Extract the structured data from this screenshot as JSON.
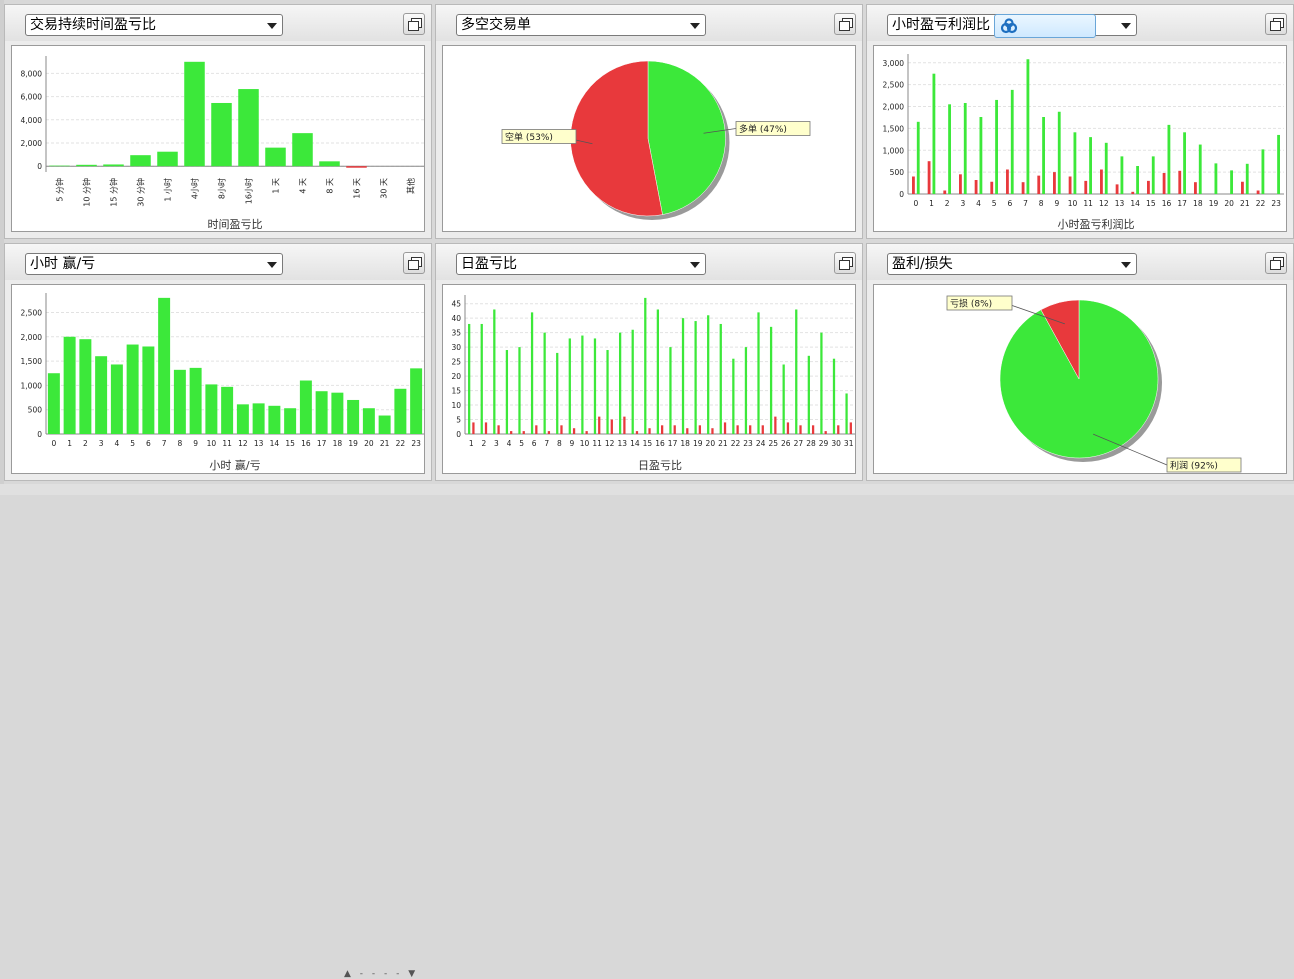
{
  "colors": {
    "green": "#3ce83a",
    "red": "#e8393c",
    "grid": "#e0e0e0"
  },
  "panels": {
    "duration": {
      "select": "交易持续时间盈亏比"
    },
    "longshort": {
      "select": "多空交易单"
    },
    "hourly_pl": {
      "select": "小时盈亏利润比"
    },
    "hour_winloss": {
      "select": "小时 赢/亏"
    },
    "daily_pl": {
      "select": "日盈亏比"
    },
    "profit_loss": {
      "select": "盈利/损失"
    }
  },
  "chart_data": [
    {
      "id": "duration",
      "type": "bar",
      "xlabel": "时间盈亏比",
      "ylim": [
        -500,
        9500
      ],
      "yticks": [
        0,
        2000,
        4000,
        6000,
        8000
      ],
      "categories": [
        "5 分钟",
        "10 分钟",
        "15 分钟",
        "30 分钟",
        "1 小时",
        "4小时",
        "8小时",
        "16小时",
        "1 天",
        "4 天",
        "8 天",
        "16 天",
        "30 天",
        "其他"
      ],
      "values": [
        50,
        120,
        150,
        950,
        1250,
        9000,
        5450,
        6650,
        1600,
        2850,
        420,
        -130,
        0,
        0
      ],
      "grid": true
    },
    {
      "id": "longshort",
      "type": "pie",
      "slices": [
        {
          "label": "多单",
          "pct": "47%",
          "value": 47,
          "color": "#3ce83a"
        },
        {
          "label": "空单",
          "pct": "53%",
          "value": 53,
          "color": "#e8393c"
        }
      ]
    },
    {
      "id": "hourly_pl",
      "type": "bar",
      "xlabel": "小时盈亏利润比",
      "ylim": [
        0,
        3200
      ],
      "yticks": [
        0,
        500,
        1000,
        1500,
        2000,
        2500,
        3000
      ],
      "categories": [
        "0",
        "1",
        "2",
        "3",
        "4",
        "5",
        "6",
        "7",
        "8",
        "9",
        "10",
        "11",
        "12",
        "13",
        "14",
        "15",
        "16",
        "17",
        "18",
        "19",
        "20",
        "21",
        "22",
        "23"
      ],
      "series": [
        {
          "color": "#e8393c",
          "values": [
            400,
            750,
            80,
            450,
            320,
            280,
            560,
            270,
            420,
            500,
            400,
            300,
            560,
            220,
            50,
            300,
            480,
            530,
            270,
            0,
            0,
            280,
            80,
            0
          ]
        },
        {
          "color": "#3ce83a",
          "values": [
            1650,
            2750,
            2050,
            2080,
            1760,
            2150,
            2380,
            3080,
            1760,
            1880,
            1410,
            1300,
            1170,
            860,
            640,
            860,
            1580,
            1410,
            1130,
            700,
            540,
            690,
            1020,
            1350
          ]
        }
      ],
      "grid": true
    },
    {
      "id": "hour_winloss",
      "type": "bar",
      "xlabel": "小时 赢/亏",
      "ylim": [
        0,
        2900
      ],
      "yticks": [
        0,
        500,
        1000,
        1500,
        2000,
        2500
      ],
      "categories": [
        "0",
        "1",
        "2",
        "3",
        "4",
        "5",
        "6",
        "7",
        "8",
        "9",
        "10",
        "11",
        "12",
        "13",
        "14",
        "15",
        "16",
        "17",
        "18",
        "19",
        "20",
        "21",
        "22",
        "23"
      ],
      "values": [
        1250,
        2000,
        1950,
        1600,
        1430,
        1840,
        1800,
        2800,
        1320,
        1360,
        1020,
        970,
        610,
        630,
        580,
        530,
        1100,
        880,
        850,
        700,
        530,
        380,
        930,
        1350
      ],
      "grid": true
    },
    {
      "id": "daily_pl",
      "type": "bar",
      "xlabel": "日盈亏比",
      "ylim": [
        0,
        48
      ],
      "yticks": [
        0,
        5,
        10,
        15,
        20,
        25,
        30,
        35,
        40,
        45
      ],
      "categories": [
        "1",
        "2",
        "3",
        "4",
        "5",
        "6",
        "7",
        "8",
        "9",
        "10",
        "11",
        "12",
        "13",
        "14",
        "15",
        "16",
        "17",
        "18",
        "19",
        "20",
        "21",
        "22",
        "23",
        "24",
        "25",
        "26",
        "27",
        "28",
        "29",
        "30",
        "31"
      ],
      "series": [
        {
          "color": "#3ce83a",
          "values": [
            38,
            38,
            43,
            29,
            30,
            42,
            35,
            28,
            33,
            34,
            33,
            29,
            35,
            36,
            47,
            43,
            30,
            40,
            39,
            41,
            38,
            26,
            30,
            42,
            37,
            24,
            43,
            27,
            35,
            26,
            14
          ]
        },
        {
          "color": "#e8393c",
          "values": [
            4,
            4,
            3,
            1,
            1,
            3,
            1,
            3,
            2,
            1,
            6,
            5,
            6,
            1,
            2,
            3,
            3,
            2,
            3,
            2,
            4,
            3,
            3,
            3,
            6,
            4,
            3,
            3,
            1,
            3,
            4
          ]
        }
      ],
      "grid": true
    },
    {
      "id": "profit_loss",
      "type": "pie",
      "slices": [
        {
          "label": "利润",
          "pct": "92%",
          "value": 92,
          "color": "#3ce83a"
        },
        {
          "label": "亏损",
          "pct": "8%",
          "value": 8,
          "color": "#e8393c"
        }
      ]
    }
  ]
}
